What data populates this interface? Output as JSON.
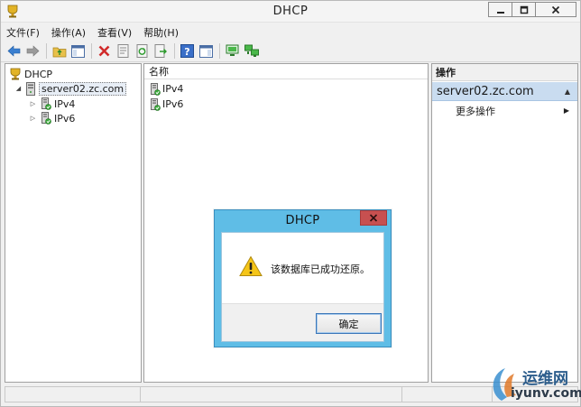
{
  "window": {
    "title": "DHCP"
  },
  "menu": {
    "items": [
      "文件(F)",
      "操作(A)",
      "查看(V)",
      "帮助(H)"
    ]
  },
  "tree": {
    "root": "DHCP",
    "server": "server02.zc.com",
    "children": [
      "IPv4",
      "IPv6"
    ]
  },
  "list": {
    "column_name": "名称",
    "rows": [
      "IPv4",
      "IPv6"
    ]
  },
  "actions": {
    "header": "操作",
    "group": "server02.zc.com",
    "items": [
      "更多操作"
    ]
  },
  "dialog": {
    "title": "DHCP",
    "message": "该数据库已成功还原。",
    "ok_label": "确定"
  },
  "watermark": {
    "line1": "运维网",
    "line2": "iyunv.com"
  },
  "colors": {
    "dialog_frame": "#5fbde6",
    "close_red": "#c75050",
    "action_group": "#c9dcf0"
  }
}
